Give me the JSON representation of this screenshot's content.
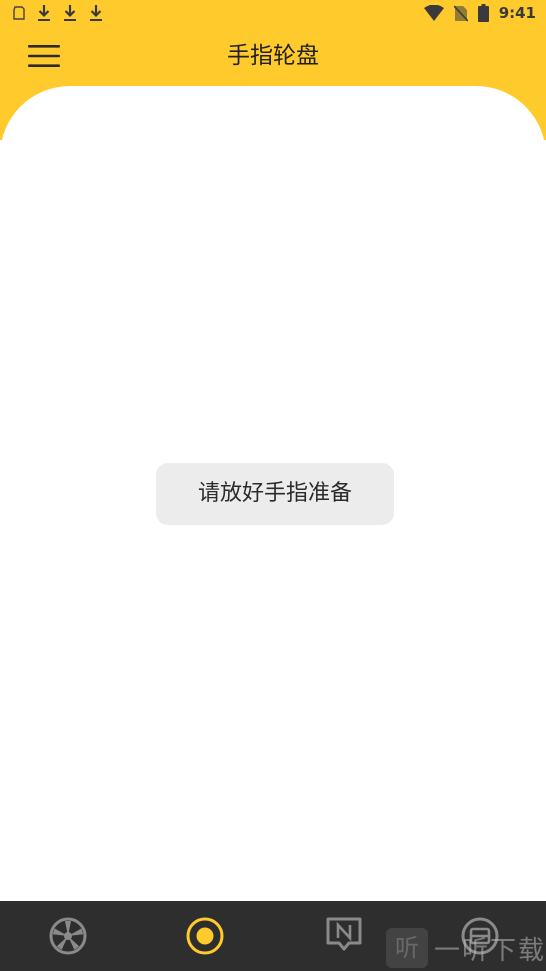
{
  "status_bar": {
    "time": "9:41",
    "left_icons": [
      "sd-card-icon",
      "download-icon",
      "download-icon",
      "download-icon"
    ],
    "right_icons": [
      "wifi-icon",
      "no-sim-icon",
      "battery-icon"
    ]
  },
  "header": {
    "title": "手指轮盘",
    "background_color": "#FFCA2C",
    "menu_icon": "hamburger-menu-icon"
  },
  "main": {
    "toast_text": "请放好手指准备"
  },
  "tabbar": {
    "background_color": "#2E2E2E",
    "tabs": [
      {
        "icon": "wheel-icon",
        "active": false
      },
      {
        "icon": "finger-target-icon",
        "active": true
      },
      {
        "icon": "notification-n-icon",
        "active": false
      },
      {
        "icon": "settings-circle-icon",
        "active": false
      }
    ]
  },
  "watermark": {
    "logo_char": "听",
    "text": "一听下载"
  }
}
